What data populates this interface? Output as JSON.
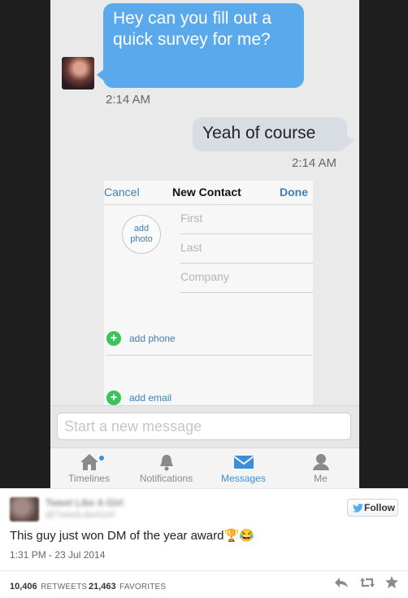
{
  "conversation": {
    "incoming": {
      "text": "Hey can you fill out a quick survey for me?",
      "time": "2:14 AM"
    },
    "outgoing": {
      "text": "Yeah of course",
      "time": "2:14 AM"
    }
  },
  "contact_card": {
    "cancel": "Cancel",
    "title": "New Contact",
    "done": "Done",
    "add_photo": "add photo",
    "fields": [
      "First",
      "Last",
      "Company"
    ],
    "add_phone": "add phone",
    "add_email": "add email"
  },
  "composer": {
    "placeholder": "Start a new message"
  },
  "tabs": [
    {
      "label": "Timelines",
      "icon": "home-icon"
    },
    {
      "label": "Notifications",
      "icon": "bell-icon"
    },
    {
      "label": "Messages",
      "icon": "envelope-icon"
    },
    {
      "label": "Me",
      "icon": "person-icon"
    }
  ],
  "tweet": {
    "author_name": "Tweet Like A Girl",
    "author_handle": "@TweetLikeAGirl",
    "follow_label": "Follow",
    "text": "This guy just won DM of the year award🏆😂",
    "timestamp": "1:31 PM - 23 Jul 2014",
    "retweets": "10,406",
    "retweets_label": "RETWEETS",
    "favorites": "21,463",
    "favorites_label": "FAVORITES"
  },
  "colors": {
    "accent": "#3b8fd9",
    "incoming_bubble": "#5aa9ec",
    "outgoing_bubble": "#d7dde3",
    "add_green": "#3cc45c"
  }
}
